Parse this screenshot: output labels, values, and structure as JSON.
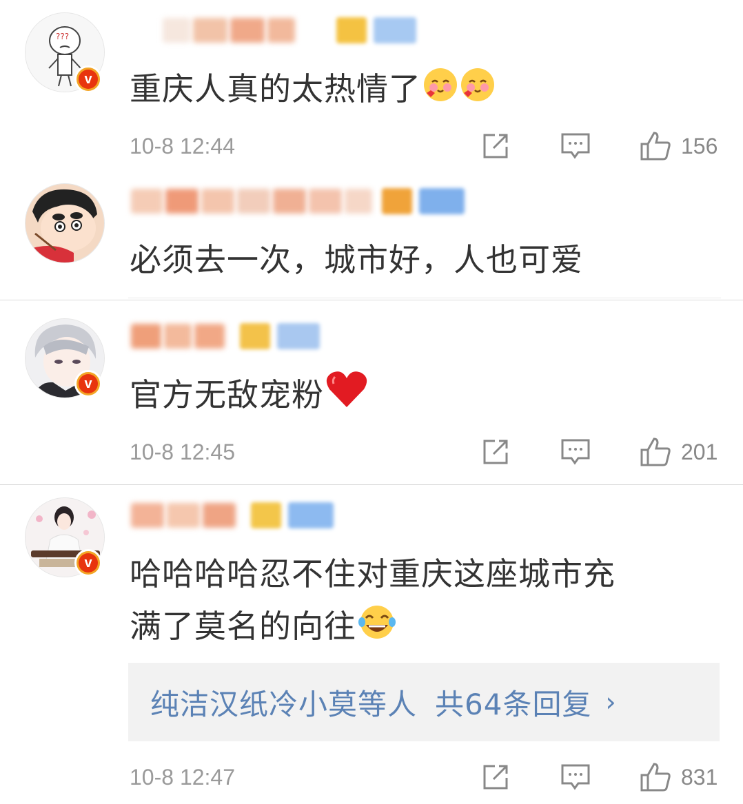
{
  "comments": [
    {
      "text": "重庆人真的太热情了",
      "emoji": [
        "blush-emoji",
        "blush-emoji"
      ],
      "verified": true,
      "time": "10-8 12:44",
      "likes": "156"
    },
    {
      "text": "必须去一次，城市好，人也可爱",
      "emoji": [],
      "verified": false
    },
    {
      "text": "官方无敌宠粉",
      "emoji": [
        "red-heart-emoji"
      ],
      "verified": true,
      "time": "10-8 12:45",
      "likes": "201"
    },
    {
      "text_line1": "哈哈哈哈忍不住对重庆这座城市充",
      "text_line2": "满了莫名的向往",
      "emoji": [
        "laughing-tears-emoji"
      ],
      "verified": true,
      "time": "10-8 12:47",
      "likes": "831"
    }
  ],
  "reply_summary": {
    "users": "纯洁汉纸冷小莫等人",
    "count_text": "共64条回复",
    "chevron": "›"
  },
  "icons": {
    "forward": "share-box-icon",
    "comment": "comment-bubble-icon",
    "like": "thumbs-up-icon",
    "verified": "v-badge-icon"
  },
  "colors": {
    "text": "#333333",
    "meta": "#9a9a9a",
    "link": "#5b82b5",
    "badge_orange": "#f3a526",
    "badge_red": "#e8340e",
    "reply_bg": "#f2f2f2"
  }
}
